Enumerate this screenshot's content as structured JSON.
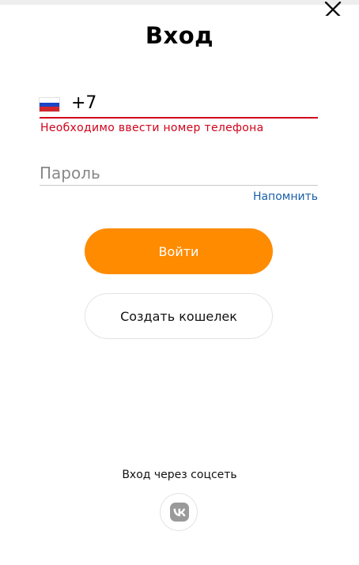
{
  "login": {
    "title": "Вход",
    "phone": {
      "country_flag": "russia-flag-icon",
      "value": "+7",
      "error": "Необходимо ввести номер телефона"
    },
    "password": {
      "placeholder": "Пароль",
      "value": ""
    },
    "remind_label": "Напомнить",
    "login_button": "Войти",
    "create_wallet_button": "Создать кошелек",
    "social_label": "Вход через соцсеть",
    "social_icons": [
      "vk-icon"
    ],
    "close_icon": "close-icon"
  },
  "colors": {
    "accent": "#ff8b00",
    "error": "#d0021b",
    "link": "#1b5fa8",
    "text": "#111111"
  }
}
